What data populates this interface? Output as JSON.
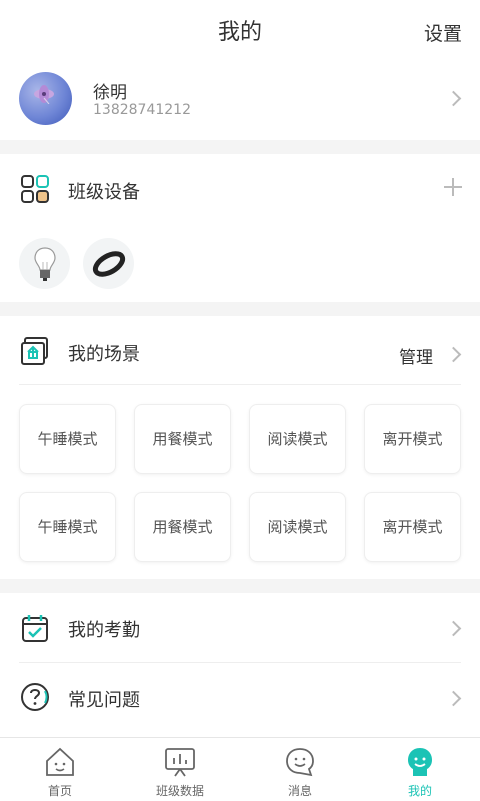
{
  "header": {
    "title": "我的",
    "settings_label": "设置"
  },
  "profile": {
    "name": "徐明",
    "phone": "13828741212"
  },
  "devices": {
    "title": "班级设备",
    "items": [
      {
        "icon": "light-bulb-icon"
      },
      {
        "icon": "wristband-icon"
      }
    ]
  },
  "scenes": {
    "title": "我的场景",
    "manage_label": "管理",
    "modes": [
      "午睡模式",
      "用餐模式",
      "阅读模式",
      "离开模式",
      "午睡模式",
      "用餐模式",
      "阅读模式",
      "离开模式"
    ]
  },
  "menu": [
    {
      "label": "我的考勤",
      "icon": "calendar-check-icon"
    },
    {
      "label": "常见问题",
      "icon": "question-icon"
    }
  ],
  "tabs": [
    {
      "label": "首页",
      "icon": "home-icon"
    },
    {
      "label": "班级数据",
      "icon": "chart-board-icon"
    },
    {
      "label": "消息",
      "icon": "message-icon"
    },
    {
      "label": "我的",
      "icon": "profile-icon"
    }
  ],
  "colors": {
    "accent": "#1bc3b5",
    "background": "#f4f4f4"
  }
}
